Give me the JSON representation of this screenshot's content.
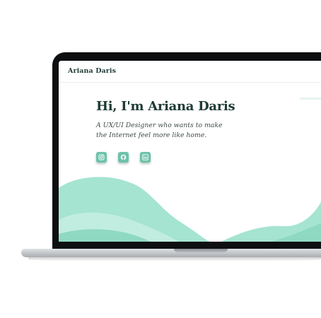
{
  "site": {
    "brand": "Ariana Daris",
    "hero": {
      "title": "Hi, I'm Ariana Daris",
      "tagline": "A UX/UI Designer who wants to make the Internet feel more like home."
    },
    "socials": [
      {
        "icon": "instagram-icon"
      },
      {
        "icon": "github-icon"
      },
      {
        "icon": "linkedin-icon"
      }
    ]
  },
  "colors": {
    "heading": "#1f3b36",
    "accent": "#6cc2aa",
    "wave": "#a5e4d1",
    "bezel": "#0e0f10"
  }
}
